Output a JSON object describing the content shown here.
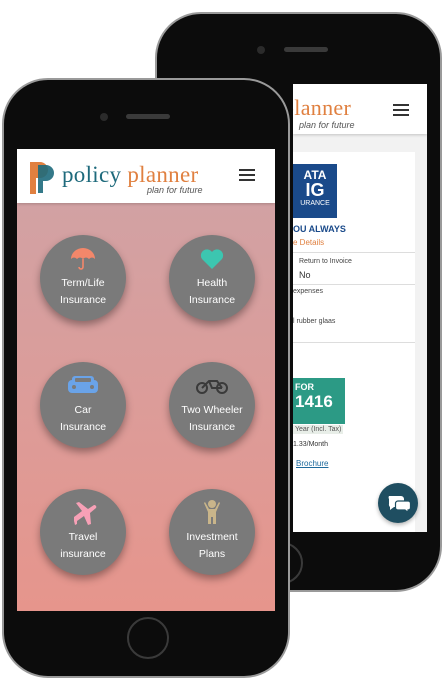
{
  "brand": {
    "name_part1": "policy",
    "name_part2": "planner",
    "tagline": "plan for future"
  },
  "colors": {
    "brand_teal": "#1e6a7c",
    "brand_orange": "#e08040",
    "tile_bg": "#7a7a7a",
    "insurer_blue": "#1a4a8a",
    "cta_green": "#2c9a85"
  },
  "menu": {
    "icon": "hamburger-icon"
  },
  "tiles": [
    {
      "line1": "Term/Life",
      "line2": "Insurance",
      "icon": "umbrella-icon"
    },
    {
      "line1": "Health",
      "line2": "Insurance",
      "icon": "heart-icon"
    },
    {
      "line1": "Car",
      "line2": "Insurance",
      "icon": "car-icon"
    },
    {
      "line1": "Two Wheeler",
      "line2": "Insurance",
      "icon": "motorbike-icon"
    },
    {
      "line1": "Travel",
      "line2": "insurance",
      "icon": "airplane-icon"
    },
    {
      "line1": "Investment",
      "line2": "Plans",
      "icon": "person-icon"
    }
  ],
  "back_screen": {
    "insurer_logo_line1": "ATA",
    "insurer_logo_line2": "IG",
    "insurer_logo_line3": "URANCE",
    "slogan": "OU ALWAYS",
    "details_link": "e Details",
    "feature_label": "Return to Invoice",
    "feature_value": "No",
    "expenses_text": "expenses",
    "rubber_text": "l rubber glaas",
    "cta_for": "FOR",
    "price": "1416",
    "price_period": "Year (Incl. Tax)",
    "monthly": "1.33/Month",
    "brochure_link": "Brochure"
  },
  "chat": {
    "icon": "chat-icon"
  }
}
